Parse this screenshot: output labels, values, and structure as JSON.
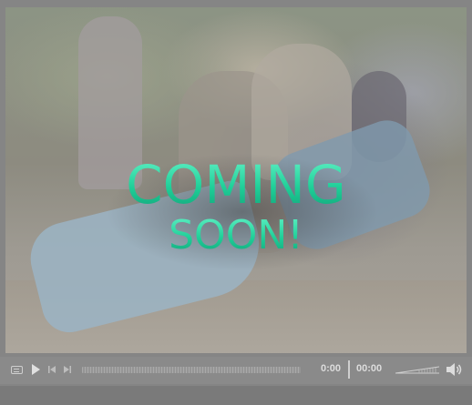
{
  "video": {
    "overlay_line1": "COMING",
    "overlay_line2": "SOON!",
    "overlay_color": "#1fcf98"
  },
  "controls": {
    "current_time": "0:00",
    "total_time": "00:00",
    "icons": [
      "captions-icon",
      "play-icon",
      "previous-icon",
      "next-icon",
      "volume-slider",
      "speaker-icon"
    ],
    "progress": 0
  }
}
